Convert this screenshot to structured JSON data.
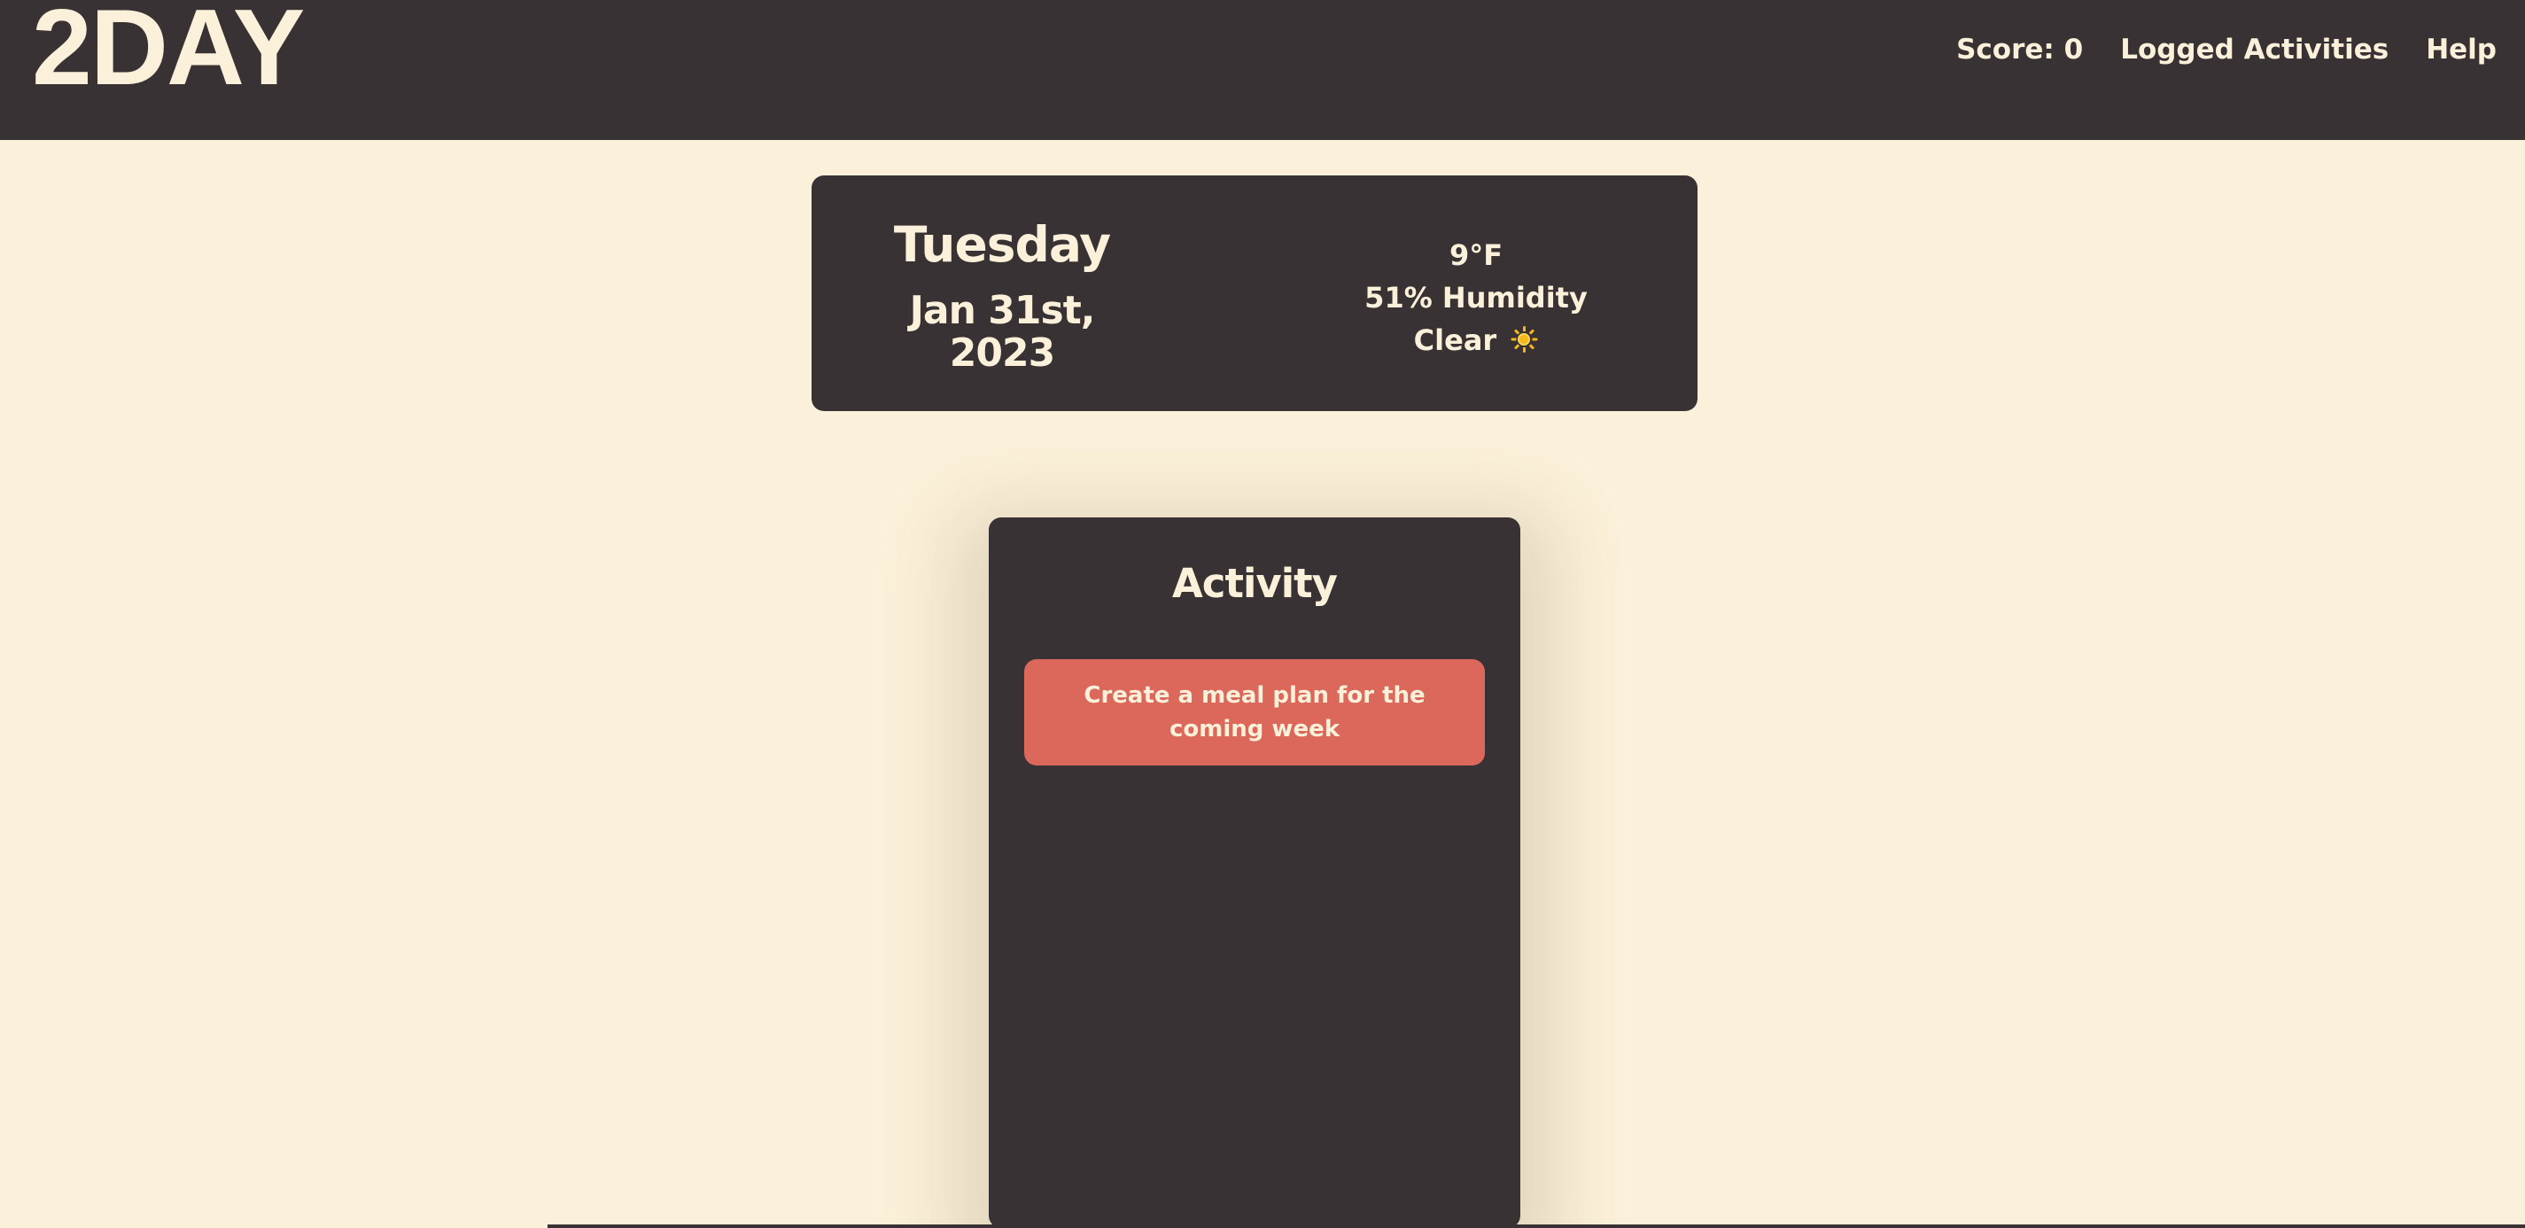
{
  "header": {
    "logo": "2DAY",
    "nav": {
      "score": "Score: 0",
      "logged_activities": "Logged Activities",
      "help": "Help"
    }
  },
  "date_card": {
    "day": "Tuesday",
    "date": "Jan 31st, 2023",
    "weather": {
      "temperature": "9°F",
      "humidity": "51% Humidity",
      "condition": "Clear",
      "condition_icon": "sun-icon"
    }
  },
  "activity_card": {
    "title": "Activity",
    "suggestion": "Create a meal plan for the coming week"
  },
  "colors": {
    "background": "#fbf0d9",
    "panel": "#383234",
    "accent": "#dc675b",
    "text": "#fbf0d9"
  }
}
